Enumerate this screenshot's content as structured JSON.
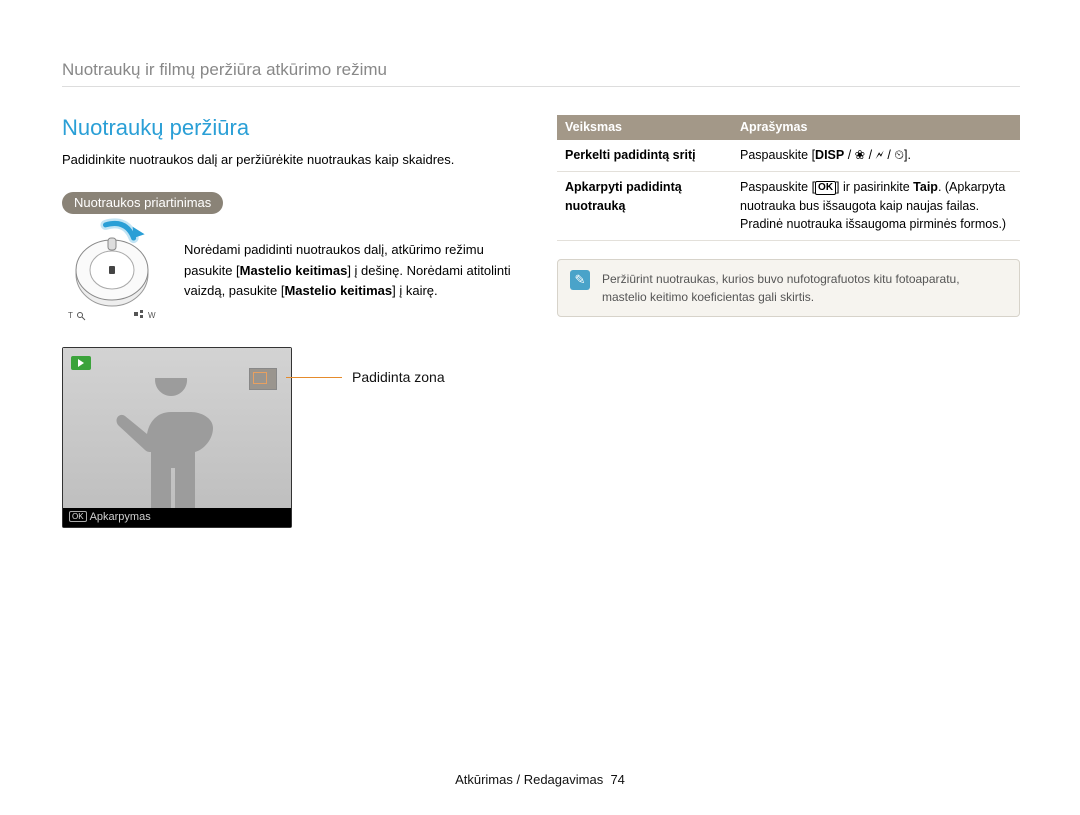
{
  "header": "Nuotraukų ir filmų peržiūra atkūrimo režimu",
  "left": {
    "title": "Nuotraukų peržiūra",
    "intro": "Padidinkite nuotraukos dalį ar peržiūrėkite nuotraukas kaip skaidres.",
    "pill": "Nuotraukos priartinimas",
    "dial": {
      "p1_a": "Norėdami padidinti nuotraukos dalį, atkūrimo režimu pasukite [",
      "p1_b": "Mastelio keitimas",
      "p1_c": "] į dešinę. Norėdami atitolinti vaizdą, pasukite [",
      "p1_d": "Mastelio keitimas",
      "p1_e": "] į kairę."
    },
    "preview_footer": "Apkarpymas",
    "callout": "Padidinta zona"
  },
  "right": {
    "thead": {
      "a": "Veiksmas",
      "b": "Aprašymas"
    },
    "rows": [
      {
        "k": "Perkelti padidintą sritį",
        "v_a": "Paspauskite [",
        "v_b": "].",
        "icons": "DISP / 🌸 / ⚡ / ⏱"
      },
      {
        "k": "Apkarpyti padidintą nuotrauką",
        "v_a": "Paspauskite [",
        "v_ok": "OK",
        "v_b": "] ir pasirinkite ",
        "v_c": "Taip",
        "v_d": ". (Apkarpyta nuotrauka bus išsaugota kaip naujas failas. Pradinė nuotrauka išsaugoma pirminės formos.)"
      }
    ],
    "note": "Peržiūrint nuotraukas, kurios buvo nufotografuotos kitu fotoaparatu, mastelio keitimo koeficientas gali skirtis."
  },
  "footer": {
    "label": "Atkūrimas / Redagavimas",
    "page": "74"
  }
}
